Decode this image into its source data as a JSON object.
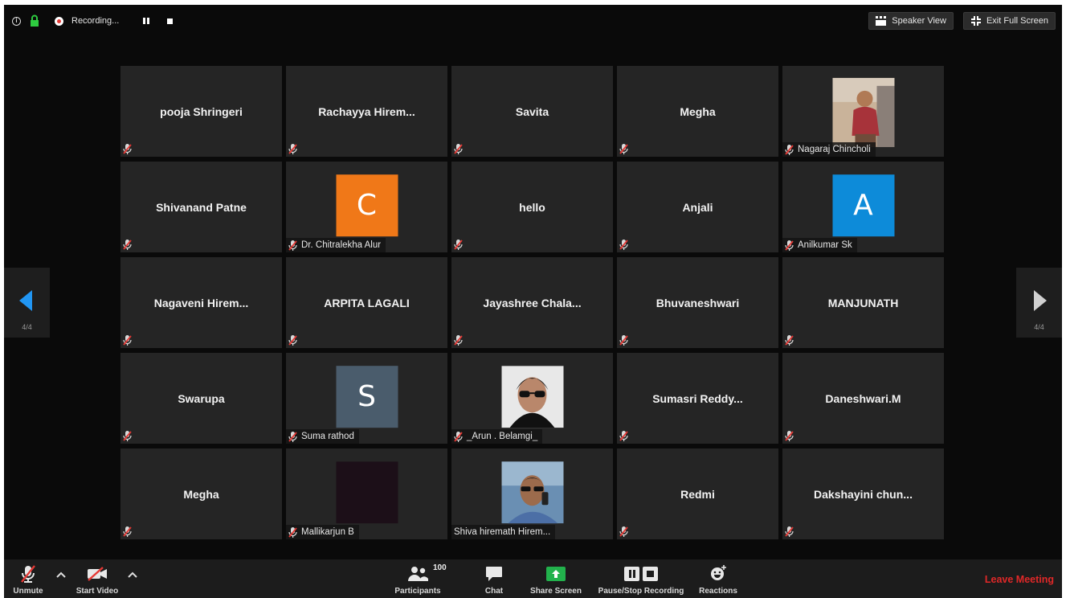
{
  "top_bar": {
    "recording_label": "Recording...",
    "speaker_view_label": "Speaker View",
    "exit_full_screen_label": "Exit Full Screen"
  },
  "pager": {
    "left_page": "4/4",
    "right_page": "4/4"
  },
  "participants": [
    {
      "name": "pooja Shringeri",
      "kind": "name"
    },
    {
      "name": "Rachayya  Hirem...",
      "kind": "name"
    },
    {
      "name": "Savita",
      "kind": "name"
    },
    {
      "name": "Megha",
      "kind": "name"
    },
    {
      "name": "Nagaraj Chincholi",
      "kind": "photo",
      "photo": "child-photo"
    },
    {
      "name": "Shivanand Patne",
      "kind": "name"
    },
    {
      "name": "Dr. Chitralekha Alur",
      "kind": "avatar",
      "initial": "C",
      "color": "#f07818"
    },
    {
      "name": "hello",
      "kind": "name"
    },
    {
      "name": "Anjali",
      "kind": "name"
    },
    {
      "name": "Anilkumar Sk",
      "kind": "avatar",
      "initial": "A",
      "color": "#0d8bd9"
    },
    {
      "name": "Nagaveni  Hirem...",
      "kind": "name"
    },
    {
      "name": "ARPITA LAGALI",
      "kind": "name"
    },
    {
      "name": "Jayashree  Chala...",
      "kind": "name"
    },
    {
      "name": "Bhuvaneshwari",
      "kind": "name"
    },
    {
      "name": "MANJUNATH",
      "kind": "name"
    },
    {
      "name": "Swarupa",
      "kind": "name"
    },
    {
      "name": "Suma rathod",
      "kind": "avatar",
      "initial": "S",
      "color": "#4a5c6c"
    },
    {
      "name": "_Arun . Belamgi_",
      "kind": "photo",
      "photo": "man-sunglasses-photo"
    },
    {
      "name": "Sumasri Reddy...",
      "kind": "name"
    },
    {
      "name": "Daneshwari.M",
      "kind": "name"
    },
    {
      "name": "Megha",
      "kind": "name"
    },
    {
      "name": "Mallikarjun B",
      "kind": "photo",
      "photo": "dark-photo"
    },
    {
      "name": "Shiva hiremath Hirem...",
      "kind": "photo",
      "photo": "man-phone-photo",
      "unmuted": true
    },
    {
      "name": "Redmi",
      "kind": "name"
    },
    {
      "name": "Dakshayini  chun...",
      "kind": "name"
    }
  ],
  "toolbar": {
    "unmute_label": "Unmute",
    "start_video_label": "Start Video",
    "participants_label": "Participants",
    "participants_count": "100",
    "chat_label": "Chat",
    "share_screen_label": "Share Screen",
    "pause_stop_label": "Pause/Stop Recording",
    "reactions_label": "Reactions",
    "leave_label": "Leave Meeting"
  },
  "colors": {
    "leave": "#e02828",
    "share": "#22b24c",
    "page_arrow_left": "#2196f3"
  }
}
